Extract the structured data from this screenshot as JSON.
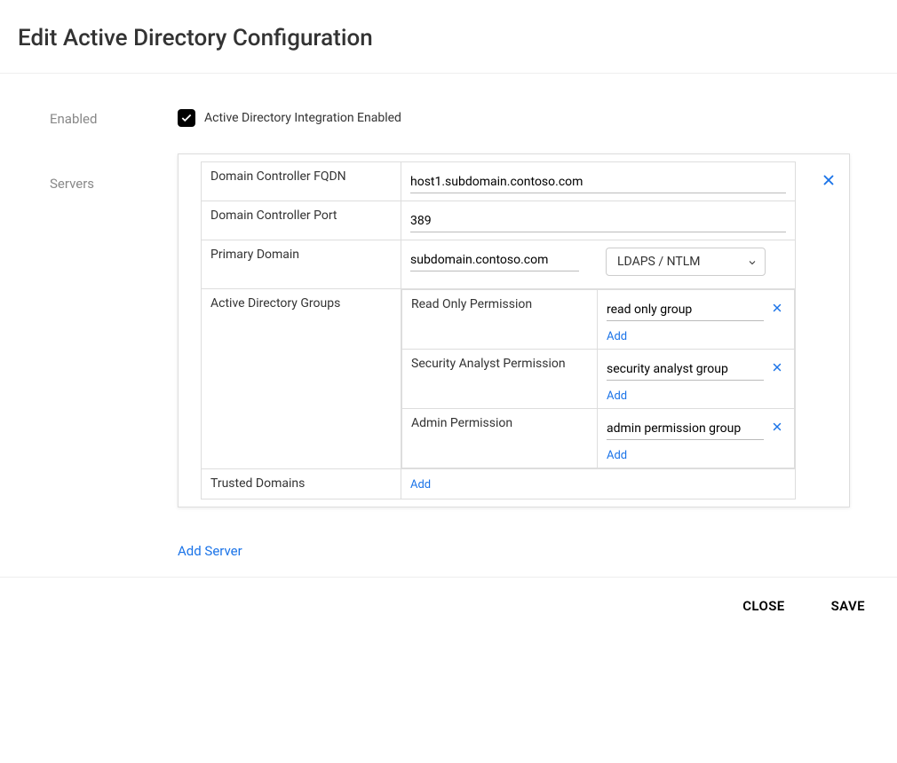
{
  "page": {
    "title": "Edit Active Directory Configuration"
  },
  "labels": {
    "enabled": "Enabled",
    "servers": "Servers",
    "checkbox": "Active Directory Integration Enabled",
    "addServer": "Add Server"
  },
  "server": {
    "fields": {
      "fqdn": {
        "label": "Domain Controller FQDN",
        "value": "host1.subdomain.contoso.com"
      },
      "port": {
        "label": "Domain Controller Port",
        "value": "389"
      },
      "primaryDomain": {
        "label": "Primary Domain",
        "value": "subdomain.contoso.com",
        "protocol": "LDAPS / NTLM"
      },
      "adGroups": {
        "label": "Active Directory Groups"
      },
      "trustedDomains": {
        "label": "Trusted Domains",
        "addLabel": "Add"
      }
    },
    "groups": {
      "readOnly": {
        "permLabel": "Read Only Permission",
        "value": "read only group",
        "addLabel": "Add"
      },
      "securityAnalyst": {
        "permLabel": "Security Analyst Permission",
        "value": "security analyst group",
        "addLabel": "Add"
      },
      "admin": {
        "permLabel": "Admin Permission",
        "value": "admin permission group",
        "addLabel": "Add"
      }
    }
  },
  "footer": {
    "close": "CLOSE",
    "save": "SAVE"
  }
}
